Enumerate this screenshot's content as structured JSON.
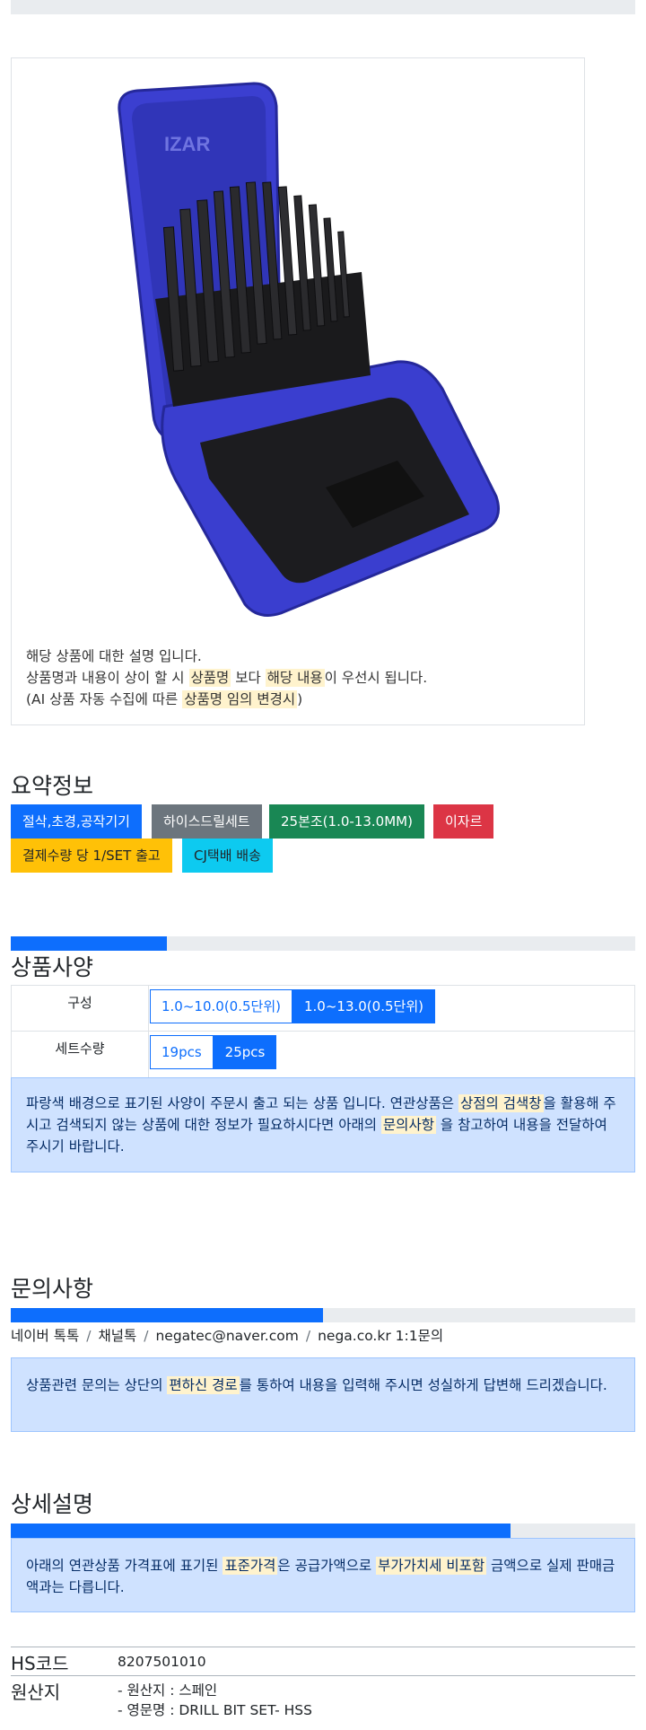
{
  "product": {
    "image_alt": "IZAR drill bit set in blue case",
    "brand_on_case": "IZAR",
    "desc_line1": "해당 상품에 대한 설명 입니다.",
    "desc_line2_a": "상품명과 내용이 상이 할 시 ",
    "desc_line2_hl1": "상품명",
    "desc_line2_b": " 보다 ",
    "desc_line2_hl2": "해당 내용",
    "desc_line2_c": "이 우선시 됩니다.",
    "desc_line3_a": "(AI 상품 자동 수집에 따른 ",
    "desc_line3_hl": "상품명 임의 변경시",
    "desc_line3_b": ")"
  },
  "summary": {
    "title": "요약정보",
    "badges": [
      {
        "label": "절삭,초경,공작기기",
        "color": "#0d6efd"
      },
      {
        "label": "하이스드릴세트",
        "color": "#6c757d"
      },
      {
        "label": "25본조(1.0-13.0MM)",
        "color": "#198754"
      },
      {
        "label": "이자르",
        "color": "#dc3545"
      },
      {
        "label": "결제수량 당 1/SET 출고",
        "color": "#ffc107"
      },
      {
        "label": "CJ택배 배송",
        "color": "#0dcaf0"
      }
    ]
  },
  "spec": {
    "progress": 0.25,
    "title": "상품사양",
    "rows": [
      {
        "label": "구성",
        "options": [
          {
            "label": "1.0~10.0(0.5단위)",
            "active": false
          },
          {
            "label": "1.0~13.0(0.5단위)",
            "active": true
          }
        ]
      },
      {
        "label": "세트수량",
        "options": [
          {
            "label": "19pcs",
            "active": false
          },
          {
            "label": "25pcs",
            "active": true
          }
        ]
      }
    ],
    "notice_a": "파랑색 배경으로 표기된 사양이 주문시 출고 되는 상품 입니다. 연관상품은 ",
    "notice_hl1": "상점의 검색창",
    "notice_b": "을 활용해 주시고 검색되지 않는 상품에 대한 정보가 필요하시다면 아래의 ",
    "notice_hl2": "문의사항",
    "notice_c": " 을 참고하여 내용을 전달하여 주시기 바랍니다."
  },
  "inquiry": {
    "title": "문의사항",
    "progress": 0.5,
    "contacts": [
      "네이버 톡톡",
      "채널톡",
      "negatec@naver.com",
      "nega.co.kr 1:1문의"
    ],
    "notice_a": "상품관련 문의는 상단의 ",
    "notice_hl": "편하신 경로",
    "notice_b": "를 통하여 내용을 입력해 주시면 성실하게 답변해 드리겠습니다."
  },
  "detail": {
    "title": "상세설명",
    "progress": 0.75,
    "notice_a": "아래의 연관상품 가격표에 표기된 ",
    "notice_hl1": "표준가격",
    "notice_b": "은 공급가액으로 ",
    "notice_hl2": "부가가치세 비포함",
    "notice_c": " 금액으로 실제 판매금액과는 다릅니다.",
    "info": [
      {
        "key": "HS코드",
        "values": [
          "8207501010"
        ]
      },
      {
        "key": "원산지",
        "values": [
          "- 원산지 : 스페인",
          "- 영문명 : DRILL BIT SET- HSS"
        ]
      }
    ]
  }
}
